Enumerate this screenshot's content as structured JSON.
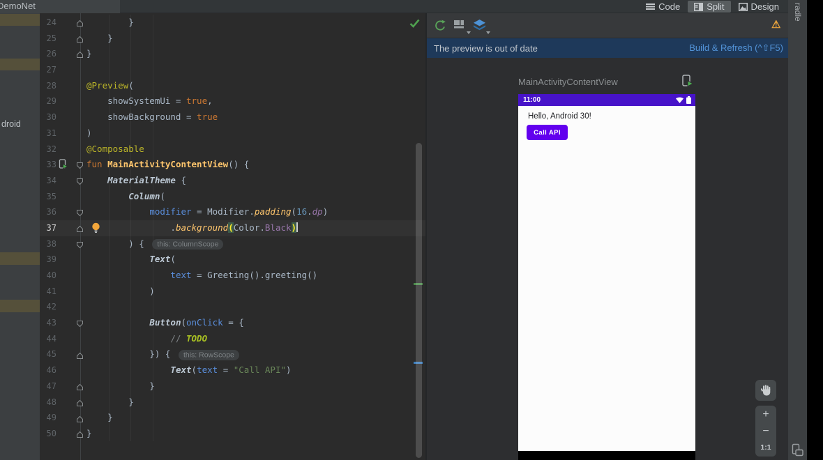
{
  "topbar": {
    "project_tab": "DemoNet",
    "modes": [
      {
        "label": "Code",
        "selected": false
      },
      {
        "label": "Split",
        "selected": true
      },
      {
        "label": "Design",
        "selected": false
      }
    ]
  },
  "project_panel": {
    "partial_item": "droid"
  },
  "editor": {
    "current_line": 37,
    "lines": [
      {
        "num": 24,
        "fold": "end",
        "tokens": [
          [
            "pl",
            "        }"
          ]
        ]
      },
      {
        "num": 25,
        "fold": "end",
        "tokens": [
          [
            "pl",
            "    }"
          ]
        ]
      },
      {
        "num": 26,
        "fold": "end",
        "tokens": [
          [
            "pl",
            "}"
          ]
        ]
      },
      {
        "num": 27,
        "tokens": []
      },
      {
        "num": 28,
        "tokens": [
          [
            "ann",
            "@Preview"
          ],
          [
            "pl",
            "("
          ]
        ]
      },
      {
        "num": 29,
        "tokens": [
          [
            "pl",
            "    showSystemUi = "
          ],
          [
            "kw",
            "true"
          ],
          [
            "pl",
            ","
          ]
        ]
      },
      {
        "num": 30,
        "tokens": [
          [
            "pl",
            "    showBackground = "
          ],
          [
            "kw",
            "true"
          ]
        ]
      },
      {
        "num": 31,
        "tokens": [
          [
            "pl",
            ")"
          ]
        ]
      },
      {
        "num": 32,
        "tokens": [
          [
            "ann",
            "@Composable"
          ]
        ]
      },
      {
        "num": 33,
        "fold": "start",
        "gutter": "run",
        "tokens": [
          [
            "kw",
            "fun "
          ],
          [
            "fn",
            "MainActivityContentView"
          ],
          [
            "pl",
            "() {"
          ]
        ]
      },
      {
        "num": 34,
        "fold": "start",
        "tokens": [
          [
            "pl",
            "    "
          ],
          [
            "comp",
            "MaterialTheme"
          ],
          [
            "pl",
            " {"
          ]
        ]
      },
      {
        "num": 35,
        "tokens": [
          [
            "pl",
            "        "
          ],
          [
            "comp",
            "Column"
          ],
          [
            "pl",
            "("
          ]
        ]
      },
      {
        "num": 36,
        "fold": "start",
        "tokens": [
          [
            "pl",
            "            "
          ],
          [
            "named",
            "modifier"
          ],
          [
            "pl",
            " = Modifier."
          ],
          [
            "ext",
            "padding"
          ],
          [
            "pl",
            "("
          ],
          [
            "num",
            "16"
          ],
          [
            "pl",
            "."
          ],
          [
            "dp",
            "dp"
          ],
          [
            "pl",
            ")"
          ]
        ]
      },
      {
        "num": 37,
        "fold": "end",
        "gutter": "bulb",
        "caret": true,
        "tokens": [
          [
            "pl",
            "                ."
          ],
          [
            "ext",
            "background"
          ],
          [
            "match",
            "("
          ],
          [
            "pl",
            "Color."
          ],
          [
            "prop",
            "Black"
          ],
          [
            "match",
            ")"
          ]
        ]
      },
      {
        "num": 38,
        "fold": "start",
        "tokens": [
          [
            "pl",
            "        ) { "
          ],
          [
            "inlay",
            "this: ColumnScope"
          ]
        ]
      },
      {
        "num": 39,
        "tokens": [
          [
            "pl",
            "            "
          ],
          [
            "comp",
            "Text"
          ],
          [
            "pl",
            "("
          ]
        ]
      },
      {
        "num": 40,
        "tokens": [
          [
            "pl",
            "                "
          ],
          [
            "named",
            "text"
          ],
          [
            "pl",
            " = Greeting().greeting()"
          ]
        ]
      },
      {
        "num": 41,
        "tokens": [
          [
            "pl",
            "            )"
          ]
        ]
      },
      {
        "num": 42,
        "tokens": []
      },
      {
        "num": 43,
        "fold": "start",
        "tokens": [
          [
            "pl",
            "            "
          ],
          [
            "comp",
            "Button"
          ],
          [
            "pl",
            "("
          ],
          [
            "named",
            "onClick"
          ],
          [
            "pl",
            " = {"
          ]
        ]
      },
      {
        "num": 44,
        "tokens": [
          [
            "pl",
            "                "
          ],
          [
            "cm",
            "// "
          ],
          [
            "todo",
            "TODO"
          ]
        ]
      },
      {
        "num": 45,
        "fold": "end",
        "tokens": [
          [
            "pl",
            "            }) { "
          ],
          [
            "inlay",
            "this: RowScope"
          ]
        ]
      },
      {
        "num": 46,
        "tokens": [
          [
            "pl",
            "                "
          ],
          [
            "comp",
            "Text"
          ],
          [
            "pl",
            "("
          ],
          [
            "named",
            "text"
          ],
          [
            "pl",
            " = "
          ],
          [
            "str",
            "\"Call API\""
          ],
          [
            "pl",
            ")"
          ]
        ]
      },
      {
        "num": 47,
        "fold": "end",
        "tokens": [
          [
            "pl",
            "            }"
          ]
        ]
      },
      {
        "num": 48,
        "fold": "end",
        "tokens": [
          [
            "pl",
            "        }"
          ]
        ]
      },
      {
        "num": 49,
        "fold": "end",
        "tokens": [
          [
            "pl",
            "    }"
          ]
        ]
      },
      {
        "num": 50,
        "fold": "end",
        "tokens": [
          [
            "pl",
            "}"
          ]
        ]
      }
    ]
  },
  "preview": {
    "banner": {
      "message": "The preview is out of date",
      "action": "Build & Refresh (^⇧F5)"
    },
    "title": "MainActivityContentView",
    "phone": {
      "time": "11:00",
      "greeting": "Hello, Android 30!",
      "button_label": "Call API"
    },
    "colors": {
      "statusbar": "#4713c9",
      "button": "#6200ee",
      "banner_link": "#5394d9",
      "warning": "#e8a33d"
    }
  },
  "right_stripe": {
    "gradle_tab": "radle"
  },
  "zoom_controls": {
    "zoom_in": "+",
    "zoom_out": "−",
    "actual": "1:1"
  }
}
